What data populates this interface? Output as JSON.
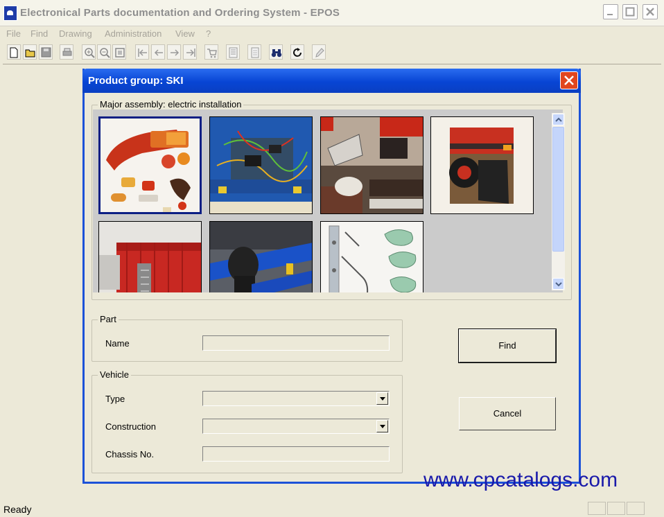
{
  "window": {
    "title": "Electronical Parts documentation and Ordering System - EPOS"
  },
  "menu": [
    "File",
    "Find",
    "Drawing",
    "Administration",
    "View",
    "?"
  ],
  "toolbar_icons": [
    "new-document-icon",
    "open-folder-icon",
    "save-icon",
    "print-icon",
    "zoom-in-icon",
    "zoom-out-icon",
    "zoom-fit-icon",
    "first-page-icon",
    "previous-page-icon",
    "next-page-icon",
    "last-page-icon",
    "cart-icon",
    "parts-list-icon",
    "document-icon",
    "binoculars-icon",
    "refresh-icon",
    "pen-icon"
  ],
  "dialog": {
    "title": "Product group: SKI",
    "assembly_legend": "Major assembly: electric installation",
    "thumbnails": [
      {
        "name": "lights-and-lamps",
        "selected": true
      },
      {
        "name": "wiring-harness",
        "selected": false
      },
      {
        "name": "underbody-lights",
        "selected": false
      },
      {
        "name": "wheel-mudflap",
        "selected": false
      },
      {
        "name": "red-trailer-body",
        "selected": false
      },
      {
        "name": "blue-axle-assembly",
        "selected": false
      },
      {
        "name": "support-parts",
        "selected": false
      }
    ],
    "part_group": {
      "legend": "Part",
      "name_label": "Name",
      "name_value": ""
    },
    "vehicle_group": {
      "legend": "Vehicle",
      "type_label": "Type",
      "type_value": "",
      "construction_label": "Construction",
      "construction_value": "",
      "chassis_label": "Chassis No.",
      "chassis_value": ""
    },
    "find_label": "Find",
    "cancel_label": "Cancel"
  },
  "status": {
    "text": "Ready"
  },
  "watermark": "www.cpcatalogs.com"
}
